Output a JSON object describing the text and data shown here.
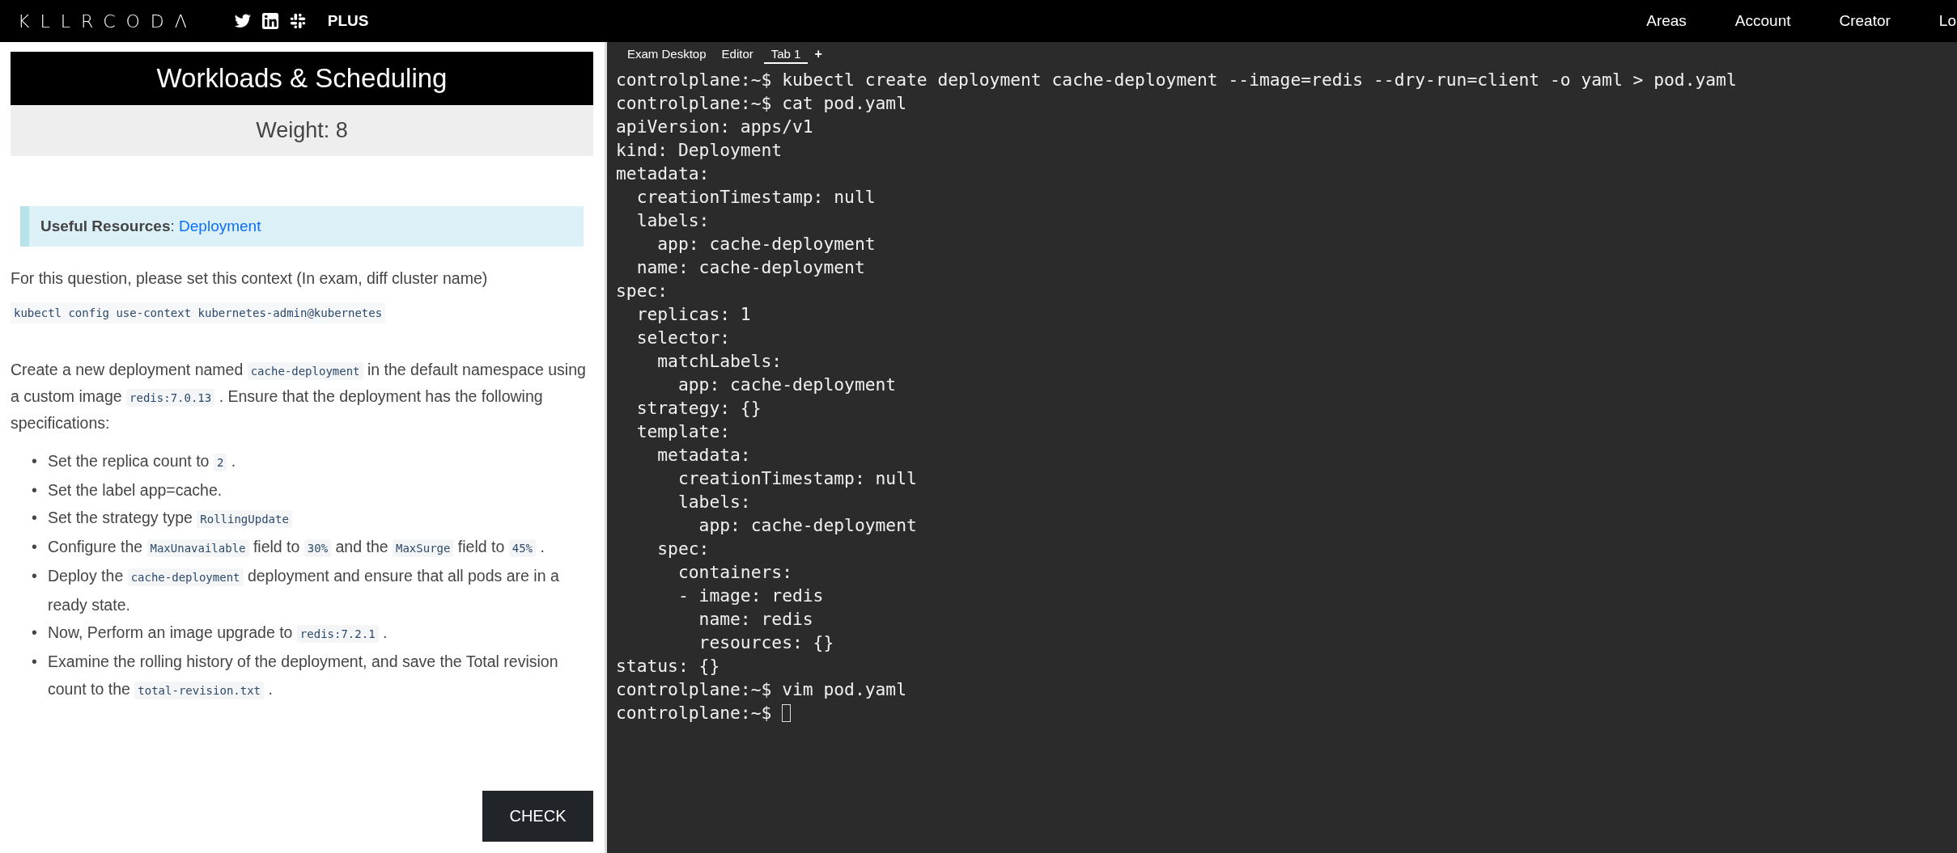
{
  "top_bar": {
    "logo": "KLLRCODΛ",
    "plus": "PLUS",
    "nav": [
      "Areas",
      "Account",
      "Creator",
      "Lo"
    ]
  },
  "task": {
    "title": "Workloads & Scheduling",
    "weight": "Weight: 8",
    "resources": {
      "label": "**Useful Resources**: ",
      "link": "Deployment"
    },
    "context_text": "For this question, please set this context (In exam, diff cluster name)",
    "context_command": "kubectl config use-context kubernetes-admin@kubernetes",
    "description": [
      {
        "kind": "text",
        "text": "Create a new deployment named "
      },
      {
        "kind": "code",
        "text": "cache-deployment"
      },
      {
        "kind": "text",
        "text": " in the default namespace using a custom image "
      },
      {
        "kind": "code",
        "text": "redis:7.0.13"
      },
      {
        "kind": "text",
        "text": " . Ensure that the deployment has the following specifications:"
      }
    ],
    "steps": [
      {
        "bullet": "•",
        "segments": [
          {
            "kind": "text",
            "text": "Set the replica count to "
          },
          {
            "kind": "code",
            "text": "2"
          },
          {
            "kind": "text",
            "text": " ."
          }
        ]
      },
      {
        "bullet": "•",
        "segments": [
          {
            "kind": "text",
            "text": "Set the label app=cache."
          }
        ]
      },
      {
        "bullet": "•",
        "segments": [
          {
            "kind": "text",
            "text": "Set the strategy type "
          },
          {
            "kind": "code",
            "text": "RollingUpdate"
          }
        ]
      },
      {
        "bullet": "•",
        "segments": [
          {
            "kind": "text",
            "text": "Configure the "
          },
          {
            "kind": "code",
            "text": "MaxUnavailable"
          },
          {
            "kind": "text",
            "text": " field to "
          },
          {
            "kind": "code",
            "text": "30%"
          },
          {
            "kind": "text",
            "text": " and the "
          },
          {
            "kind": "code",
            "text": "MaxSurge"
          },
          {
            "kind": "text",
            "text": " field to "
          },
          {
            "kind": "code",
            "text": "45%"
          },
          {
            "kind": "text",
            "text": " ."
          }
        ]
      },
      {
        "bullet": "•",
        "segments": [
          {
            "kind": "text",
            "text": "Deploy the "
          },
          {
            "kind": "code",
            "text": "cache-deployment"
          },
          {
            "kind": "text",
            "text": " deployment and ensure that all pods are in a ready state."
          }
        ]
      },
      {
        "bullet": "•",
        "segments": [
          {
            "kind": "text",
            "text": "Now, Perform an image upgrade to "
          },
          {
            "kind": "code",
            "text": "redis:7.2.1"
          },
          {
            "kind": "text",
            "text": " ."
          }
        ]
      },
      {
        "bullet": "•",
        "segments": [
          {
            "kind": "text",
            "text": "Examine the rolling history of the deployment, and save the Total revision count to the "
          },
          {
            "kind": "code",
            "text": "total-revision.txt"
          },
          {
            "kind": "text",
            "text": " ."
          }
        ]
      }
    ],
    "check_button": "CHECK"
  },
  "terminal": {
    "tabs": [
      {
        "label": "Exam Desktop",
        "selected": false
      },
      {
        "label": "Editor",
        "selected": false
      },
      {
        "label": "Tab 1",
        "selected": true
      }
    ],
    "add_tab": "+",
    "lines": [
      "controlplane:~$ kubectl create deployment cache-deployment --image=redis --dry-run=client -o yaml > pod.yaml",
      "controlplane:~$ cat pod.yaml",
      "apiVersion: apps/v1",
      "kind: Deployment",
      "metadata:",
      "  creationTimestamp: null",
      "  labels:",
      "    app: cache-deployment",
      "  name: cache-deployment",
      "spec:",
      "  replicas: 1",
      "  selector:",
      "    matchLabels:",
      "      app: cache-deployment",
      "  strategy: {}",
      "  template:",
      "    metadata:",
      "      creationTimestamp: null",
      "      labels:",
      "        app: cache-deployment",
      "    spec:",
      "      containers:",
      "      - image: redis",
      "        name: redis",
      "        resources: {}",
      "status: {}",
      "controlplane:~$ vim pod.yaml",
      "controlplane:~$ "
    ],
    "cursor": true
  }
}
